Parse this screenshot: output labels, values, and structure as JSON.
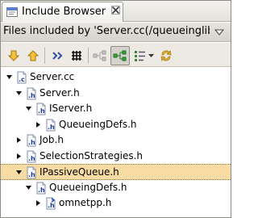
{
  "view": {
    "tab_title": "Include Browser",
    "header": "Files included by 'Server.cc(/queueinglib)"
  },
  "toolbar": {
    "buttons": [
      {
        "name": "next-match-icon"
      },
      {
        "name": "previous-match-icon"
      },
      {
        "name": "link-with-editor-icon"
      },
      {
        "name": "collapse-all-icon"
      },
      {
        "name": "show-includers-icon"
      },
      {
        "name": "show-included-files-icon"
      },
      {
        "name": "show-include-history-icon"
      },
      {
        "name": "refresh-icon"
      }
    ]
  },
  "tree": {
    "rows": [
      {
        "label": "Server.cc",
        "type": "c",
        "level": 0,
        "expanded": true
      },
      {
        "label": "Server.h",
        "type": "h",
        "level": 1,
        "expanded": true
      },
      {
        "label": "IServer.h",
        "type": "h",
        "level": 2,
        "expanded": true
      },
      {
        "label": "QueueingDefs.h",
        "type": "h",
        "level": 3,
        "expanded": false
      },
      {
        "label": "Job.h",
        "type": "h",
        "level": 1,
        "expanded": false
      },
      {
        "label": "SelectionStrategies.h",
        "type": "h",
        "level": 1,
        "expanded": false
      },
      {
        "label": "IPassiveQueue.h",
        "type": "h",
        "level": 1,
        "expanded": true,
        "selected": true
      },
      {
        "label": "QueueingDefs.h",
        "type": "h",
        "level": 2,
        "expanded": true
      },
      {
        "label": "omnetpp.h",
        "type": "h-system",
        "level": 3,
        "expanded": false
      }
    ]
  },
  "colors": {
    "selection": "#f8dca3",
    "header_blue": "#3a5ea8"
  }
}
